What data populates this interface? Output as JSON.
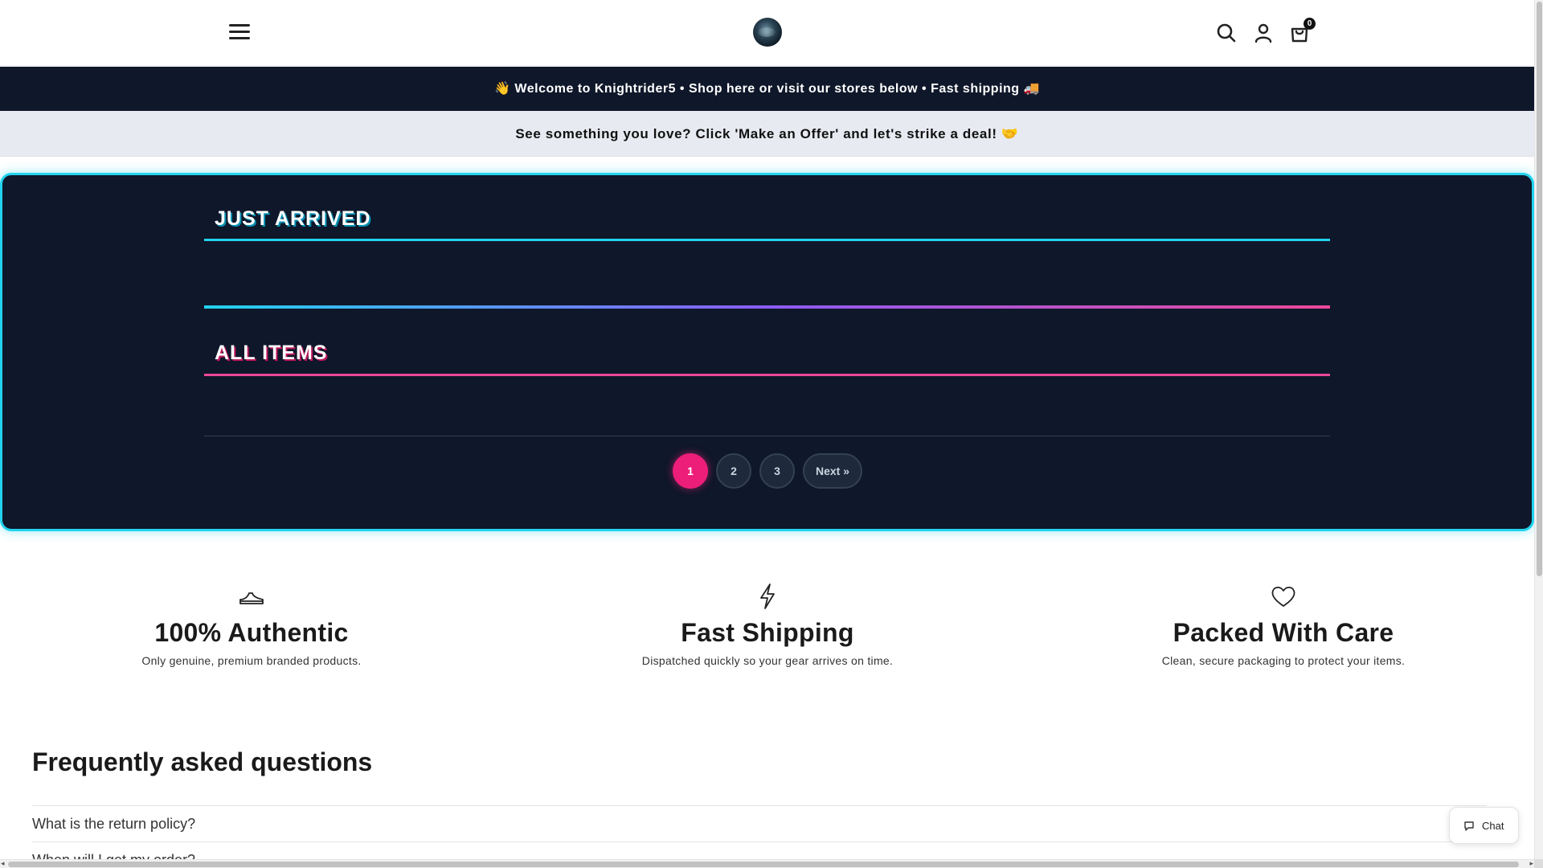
{
  "header": {
    "cart_count": "0",
    "icons": {
      "menu": "hamburger-icon",
      "search": "search-icon",
      "account": "user-icon",
      "cart": "shopping-bag-icon",
      "logo": "store-logo"
    }
  },
  "announcements": {
    "primary": "👋 Welcome to Knightrider5 • Shop here or visit our stores below • Fast shipping 🚚",
    "secondary": "See something you love? Click 'Make an Offer' and let's strike a deal! 🤝"
  },
  "collections": {
    "just_arrived_title": "JUST ARRIVED",
    "all_items_title": "ALL ITEMS"
  },
  "pagination": {
    "pages": [
      "1",
      "2",
      "3"
    ],
    "current": "1",
    "next_label": "Next »"
  },
  "features": [
    {
      "icon": "sneaker-icon",
      "title": "100% Authentic",
      "text": "Only genuine, premium branded products."
    },
    {
      "icon": "lightning-icon",
      "title": "Fast Shipping",
      "text": "Dispatched quickly so your gear arrives on time."
    },
    {
      "icon": "heart-icon",
      "title": "Packed With Care",
      "text": "Clean, secure packaging to protect your items."
    }
  ],
  "faq": {
    "title": "Frequently asked questions",
    "items": [
      "What is the return policy?",
      "When will I get my order?"
    ]
  },
  "chat": {
    "label": "Chat"
  },
  "colors": {
    "panel_bg": "#0f172a",
    "accent_cyan": "#22d3ee",
    "accent_pink": "#ec1e79"
  }
}
